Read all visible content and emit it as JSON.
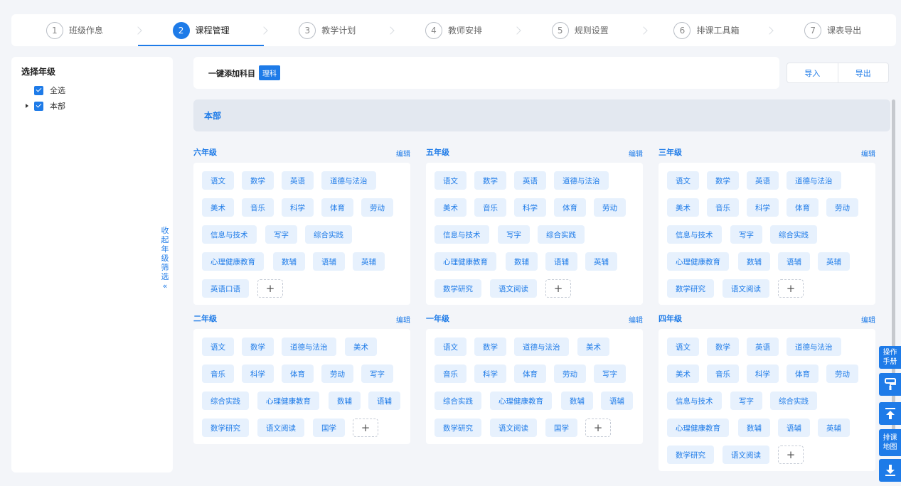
{
  "steps": [
    {
      "num": "1",
      "label": "班级作息"
    },
    {
      "num": "2",
      "label": "课程管理"
    },
    {
      "num": "3",
      "label": "教学计划"
    },
    {
      "num": "4",
      "label": "教师安排"
    },
    {
      "num": "5",
      "label": "规则设置"
    },
    {
      "num": "6",
      "label": "排课工具箱"
    },
    {
      "num": "7",
      "label": "课表导出"
    }
  ],
  "sidebar": {
    "title": "选择年级",
    "select_all": "全选",
    "campus": "本部",
    "collapse": [
      "收",
      "起",
      "年",
      "级",
      "筛",
      "选",
      "«"
    ]
  },
  "toolbar": {
    "quick_add_label": "一键添加科目",
    "quick_add_chip": "理科",
    "import": "导入",
    "export": "导出"
  },
  "campus_title": "本部",
  "edit_label": "编辑",
  "grades": [
    {
      "name": "六年级",
      "subjects": [
        "语文",
        "数学",
        "英语",
        "道德与法治",
        "美术",
        "音乐",
        "科学",
        "体育",
        "劳动",
        "信息与技术",
        "写字",
        "综合实践",
        "心理健康教育",
        "数辅",
        "语辅",
        "英辅",
        "英语口语"
      ]
    },
    {
      "name": "五年级",
      "subjects": [
        "语文",
        "数学",
        "英语",
        "道德与法治",
        "美术",
        "音乐",
        "科学",
        "体育",
        "劳动",
        "信息与技术",
        "写字",
        "综合实践",
        "心理健康教育",
        "数辅",
        "语辅",
        "英辅",
        "数学研究",
        "语文阅读"
      ]
    },
    {
      "name": "三年级",
      "subjects": [
        "语文",
        "数学",
        "英语",
        "道德与法治",
        "美术",
        "音乐",
        "科学",
        "体育",
        "劳动",
        "信息与技术",
        "写字",
        "综合实践",
        "心理健康教育",
        "数辅",
        "语辅",
        "英辅",
        "数学研究",
        "语文阅读"
      ]
    },
    {
      "name": "二年级",
      "subjects": [
        "语文",
        "数学",
        "道德与法治",
        "美术",
        "音乐",
        "科学",
        "体育",
        "劳动",
        "写字",
        "综合实践",
        "心理健康教育",
        "数辅",
        "语辅",
        "数学研究",
        "语文阅读",
        "国学"
      ]
    },
    {
      "name": "一年级",
      "subjects": [
        "语文",
        "数学",
        "道德与法治",
        "美术",
        "音乐",
        "科学",
        "体育",
        "劳动",
        "写字",
        "综合实践",
        "心理健康教育",
        "数辅",
        "语辅",
        "数学研究",
        "语文阅读",
        "国学"
      ]
    },
    {
      "name": "四年级",
      "subjects": [
        "语文",
        "数学",
        "英语",
        "道德与法治",
        "美术",
        "音乐",
        "科学",
        "体育",
        "劳动",
        "信息与技术",
        "写字",
        "综合实践",
        "心理健康教育",
        "数辅",
        "语辅",
        "英辅",
        "数学研究",
        "语文阅读"
      ]
    }
  ],
  "add_symbol": "+",
  "tools": {
    "manual": "操作手册",
    "schedule_map": "排课地图"
  },
  "icons": [
    "brush-icon",
    "to-top-icon",
    "download-icon"
  ]
}
